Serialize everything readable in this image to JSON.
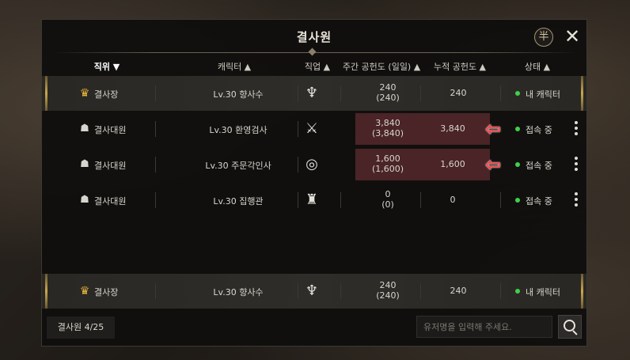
{
  "window": {
    "title": "결사원"
  },
  "header": {
    "columns": [
      {
        "label": "직위 ▼"
      },
      {
        "label": "캐릭터 ▲"
      },
      {
        "label": "직업 ▲"
      },
      {
        "label": "주간 공헌도 (일일) ▲"
      },
      {
        "label": "누적 공헌도 ▲"
      },
      {
        "label": "상태 ▲"
      }
    ]
  },
  "rows": [
    {
      "rank": "결사장",
      "rank_icon": "crown-icon",
      "character": "Lv.30  향사수",
      "job_icon": "job-archer-icon",
      "weekly": "240",
      "daily": "(240)",
      "total": "240",
      "status": "내 캐릭터"
    },
    {
      "rank": "결사대원",
      "rank_icon": "helmet-icon",
      "character": "Lv.30  환영검사",
      "job_icon": "job-swordsman-icon",
      "weekly": "3,840",
      "daily": "(3,840)",
      "total": "3,840",
      "status": "접속 중"
    },
    {
      "rank": "결사대원",
      "rank_icon": "helmet-icon",
      "character": "Lv.30  주문각인사",
      "job_icon": "job-spellcaster-icon",
      "weekly": "1,600",
      "daily": "(1,600)",
      "total": "1,600",
      "status": "접속 중"
    },
    {
      "rank": "결사대원",
      "rank_icon": "helmet-icon",
      "character": "Lv.30  집행관",
      "job_icon": "job-executor-icon",
      "weekly": "0",
      "daily": "(0)",
      "total": "0",
      "status": "접속 중"
    }
  ],
  "my_row": {
    "rank": "결사장",
    "character": "Lv.30  향사수",
    "weekly": "240",
    "daily": "(240)",
    "total": "240",
    "status": "내 캐릭터"
  },
  "footer": {
    "member_count": "결사원  4/25",
    "search_placeholder": "유저명을 입력해 주세요."
  },
  "colors": {
    "online": "#3fd04a",
    "highlight": "#4a2427",
    "arrow": "#ff3b3b",
    "crown": "#e9b53d"
  }
}
